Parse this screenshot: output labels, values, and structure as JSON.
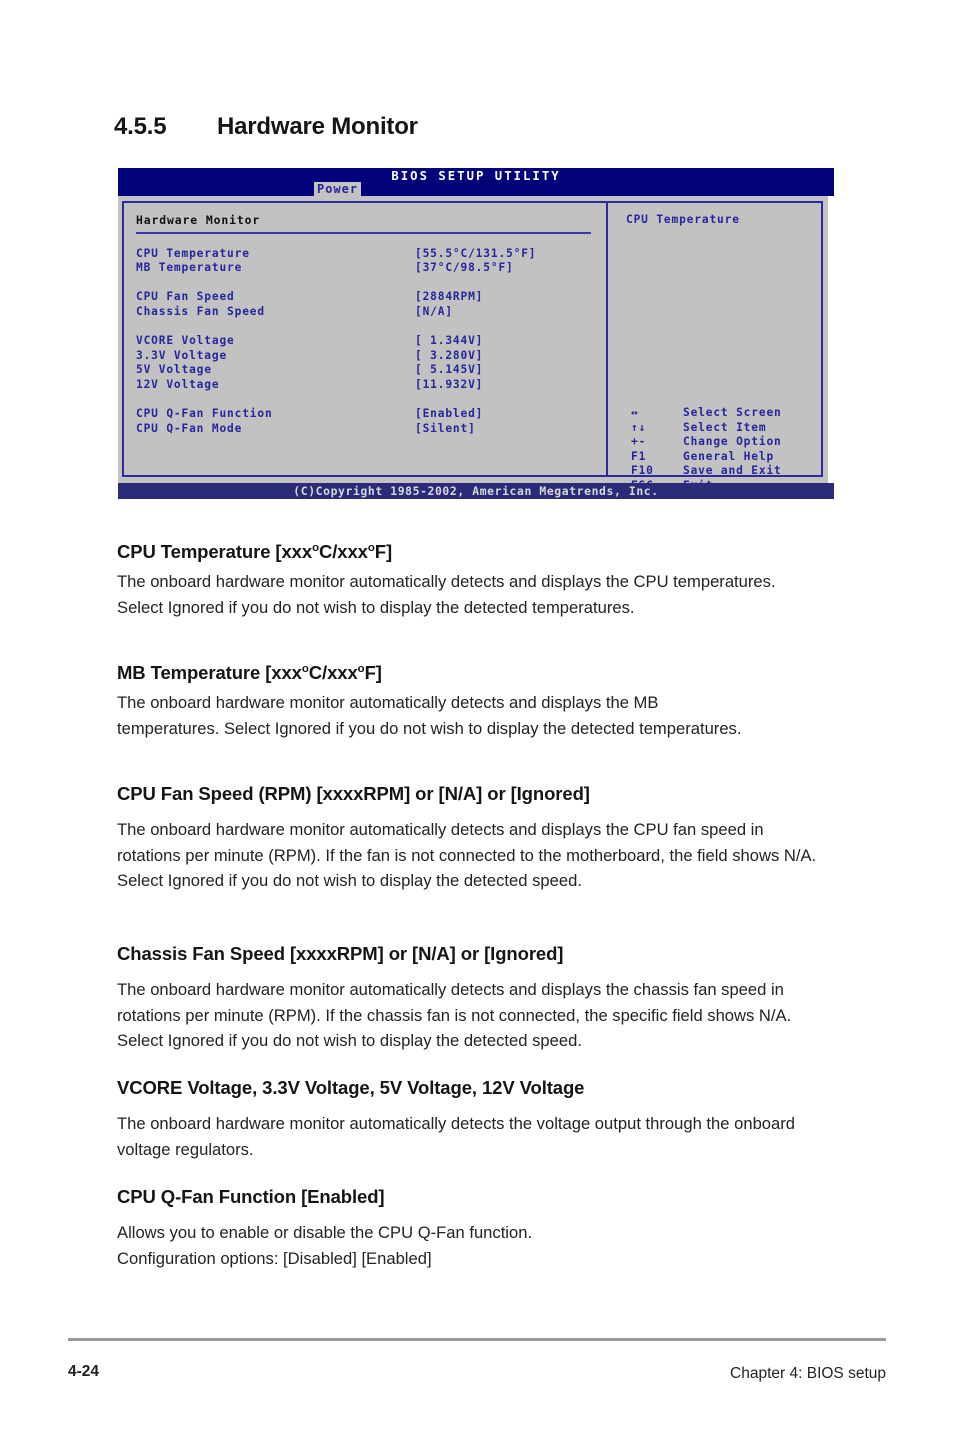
{
  "page": {
    "section_number": "4.5.5",
    "section_title": "Hardware Monitor",
    "folio": "4-24",
    "chapter": "Chapter 4: BIOS setup"
  },
  "bios": {
    "title": "BIOS SETUP UTILITY",
    "active_tab": "Power",
    "group_title": "Hardware Monitor",
    "copyright": "(C)Copyright 1985-2002, American Megatrends, Inc.",
    "help_title": "CPU Temperature",
    "rows": [
      {
        "label": "CPU Temperature",
        "value": "[55.5°C/131.5°F]"
      },
      {
        "label": "MB Temperature",
        "value": "[37°C/98.5°F]"
      },
      {
        "label": "CPU Fan Speed",
        "value": "[2884RPM]"
      },
      {
        "label": "Chassis Fan Speed",
        "value": "[N/A]"
      },
      {
        "label": "VCORE Voltage",
        "value": "[ 1.344V]"
      },
      {
        "label": "3.3V Voltage",
        "value": "[ 3.280V]"
      },
      {
        "label": "5V Voltage",
        "value": "[ 5.145V]"
      },
      {
        "label": "12V Voltage",
        "value": "[11.932V]"
      },
      {
        "label": "CPU Q-Fan Function",
        "value": "[Enabled]"
      },
      {
        "label": "CPU Q-Fan Mode",
        "value": "[Silent]"
      }
    ],
    "keys": [
      {
        "key": "↔",
        "desc": "Select Screen"
      },
      {
        "key": "↑↓",
        "desc": "Select Item"
      },
      {
        "key": "+-",
        "desc": "Change Option"
      },
      {
        "key": "F1",
        "desc": "General Help"
      },
      {
        "key": "F10",
        "desc": "Save and Exit"
      },
      {
        "key": "ESC",
        "desc": "Exit"
      }
    ]
  },
  "sections": [
    {
      "heading_pre": "CPU Temperature [xxx",
      "heading_mid": "C/xxx",
      "heading_post": "F]",
      "body": "The onboard hardware monitor automatically detects and displays the CPU temperatures. Select Ignored if you do not wish to display the detected temperatures."
    },
    {
      "heading_pre": "MB Temperature [xxx",
      "heading_mid": "C/xxx",
      "heading_post": "F]",
      "body": "The onboard hardware monitor automatically detects and displays the MB temperatures. Select Ignored if you do not wish to display the detected temperatures."
    },
    {
      "heading": "CPU Fan Speed (RPM) [xxxxRPM] or [N/A] or [Ignored]",
      "body": "The onboard hardware monitor automatically detects and displays the CPU fan speed in rotations per minute (RPM). If the fan is not connected to the motherboard, the field shows N/A. Select Ignored if you do not wish to display the detected speed."
    },
    {
      "heading": "Chassis Fan Speed [xxxxRPM] or [N/A] or [Ignored]",
      "body": "The onboard hardware monitor automatically detects and displays the chassis fan speed in rotations per minute (RPM). If the chassis fan is not connected, the specific field shows N/A. Select Ignored if you do not wish to display the detected speed."
    },
    {
      "heading": "VCORE Voltage, 3.3V Voltage, 5V Voltage, 12V Voltage",
      "body": "The onboard hardware monitor automatically detects the voltage output through the onboard voltage regulators."
    },
    {
      "heading": "CPU Q-Fan Function [Enabled]",
      "body_line1": "Allows you to enable or disable the CPU Q-Fan function.",
      "body_line2": "Configuration options: [Disabled] [Enabled]"
    }
  ]
}
